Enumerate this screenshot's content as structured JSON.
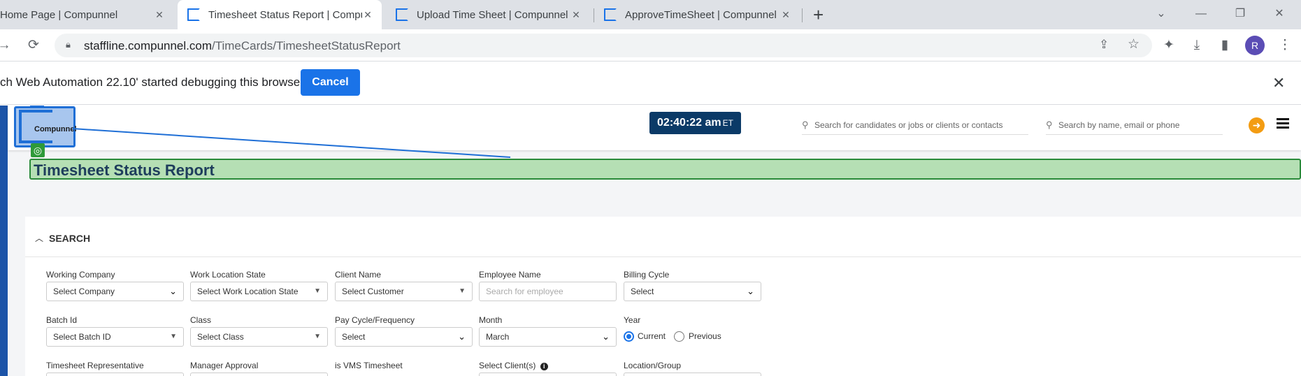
{
  "browser": {
    "tabs": [
      {
        "title": "Home Page | Compunnel",
        "active": false
      },
      {
        "title": "Timesheet Status Report | Compu",
        "active": true
      },
      {
        "title": "Upload Time Sheet | Compunnel",
        "active": false
      },
      {
        "title": "ApproveTimeSheet | Compunnel",
        "active": false
      }
    ],
    "new_tab_glyph": "+",
    "url_host": "staffline.compunnel.com",
    "url_path": "/TimeCards/TimesheetStatusReport",
    "profile_initial": "R",
    "infobar_text": "ch Web Automation 22.10' started debugging this browser",
    "infobar_cancel": "Cancel",
    "accent_color": "#1a73e8"
  },
  "header": {
    "logo_text": "Compunnel",
    "clock_time": "02:40:22 am",
    "clock_zone": "ET",
    "search_candidates_placeholder": "Search for candidates or jobs or clients or contacts",
    "search_people_placeholder": "Search by name, email or phone"
  },
  "page": {
    "title": "Timesheet Status Report",
    "search_section": {
      "title": "SEARCH",
      "fields": {
        "working_company": {
          "label": "Working Company",
          "value": "Select Company"
        },
        "work_location_state": {
          "label": "Work Location State",
          "value": "Select Work Location State"
        },
        "client_name": {
          "label": "Client Name",
          "value": "Select Customer"
        },
        "employee_name": {
          "label": "Employee Name",
          "placeholder": "Search for employee"
        },
        "billing_cycle": {
          "label": "Billing Cycle",
          "value": "Select"
        },
        "batch_id": {
          "label": "Batch Id",
          "value": "Select Batch ID"
        },
        "class": {
          "label": "Class",
          "value": "Select Class"
        },
        "pay_cycle": {
          "label": "Pay Cycle/Frequency",
          "value": "Select"
        },
        "month": {
          "label": "Month",
          "value": "March"
        },
        "year": {
          "label": "Year",
          "options": [
            "Current",
            "Previous"
          ],
          "selected": "Current"
        },
        "timesheet_rep": {
          "label": "Timesheet Representative"
        },
        "manager_approval": {
          "label": "Manager Approval"
        },
        "vms_timesheet": {
          "label": "is VMS Timesheet"
        },
        "select_clients": {
          "label": "Select Client(s)"
        },
        "location_group": {
          "label": "Location/Group"
        }
      }
    }
  }
}
